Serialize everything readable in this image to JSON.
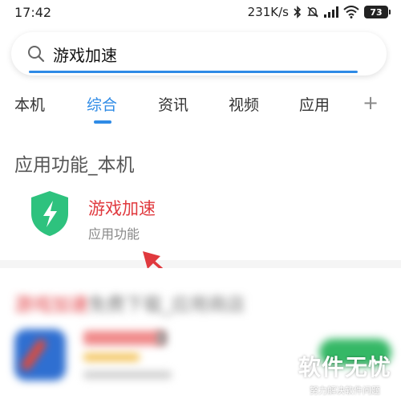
{
  "status_bar": {
    "time": "17:42",
    "network_speed": "231K/s",
    "battery": "73"
  },
  "search": {
    "query": "游戏加速",
    "icon": "search-icon"
  },
  "tabs": [
    {
      "label": "本机",
      "active": false
    },
    {
      "label": "综合",
      "active": true
    },
    {
      "label": "资讯",
      "active": false
    },
    {
      "label": "视频",
      "active": false
    },
    {
      "label": "应用",
      "active": false
    }
  ],
  "tab_add": "+",
  "section": {
    "title": "应用功能_本机",
    "result": {
      "title": "游戏加速",
      "subtitle": "应用功能",
      "icon": "shield-lightning-icon"
    }
  },
  "blurred_section": {
    "title_red": "游戏加速",
    "title_gray": "免费下载_应用商店"
  },
  "watermark": {
    "main": "软件无忧",
    "sub": "努力解决软件问题"
  },
  "colors": {
    "accent": "#2f8be6",
    "highlight": "#e0393e",
    "shield": "#2ec27e"
  }
}
